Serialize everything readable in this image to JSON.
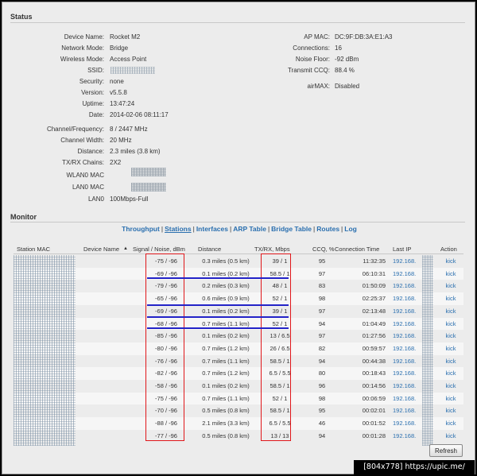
{
  "status": {
    "title": "Status",
    "left": [
      {
        "label": "Device Name:",
        "value": "Rocket M2"
      },
      {
        "label": "Network Mode:",
        "value": "Bridge"
      },
      {
        "label": "Wireless Mode:",
        "value": "Access Point"
      },
      {
        "label": "SSID:",
        "value": ""
      },
      {
        "label": "Security:",
        "value": "none"
      },
      {
        "label": "Version:",
        "value": "v5.5.8"
      },
      {
        "label": "Uptime:",
        "value": "13:47:24"
      },
      {
        "label": "Date:",
        "value": "2014-02-06 08:11:17"
      },
      {
        "label": "Channel/Frequency:",
        "value": "8 / 2447 MHz"
      },
      {
        "label": "Channel Width:",
        "value": "20 MHz"
      },
      {
        "label": "Distance:",
        "value": "2.3 miles (3.8 km)"
      },
      {
        "label": "TX/RX Chains:",
        "value": "2X2"
      },
      {
        "label": "WLAN0 MAC",
        "value": ""
      },
      {
        "label": "LAN0 MAC",
        "value": ""
      },
      {
        "label": "LAN0",
        "value": "100Mbps-Full"
      }
    ],
    "right": [
      {
        "label": "AP MAC:",
        "value": "DC:9F:DB:3A:E1:A3"
      },
      {
        "label": "Connections:",
        "value": "16"
      },
      {
        "label": "Noise Floor:",
        "value": "-92 dBm"
      },
      {
        "label": "Transmit CCQ:",
        "value": "88.4 %"
      },
      {
        "label": "airMAX:",
        "value": "Disabled"
      }
    ]
  },
  "monitor": {
    "title": "Monitor",
    "tabs": [
      "Throughput",
      "Stations",
      "Interfaces",
      "ARP Table",
      "Bridge Table",
      "Routes",
      "Log"
    ],
    "active_tab": "Stations",
    "columns": [
      "Station MAC",
      "Device Name",
      "Signal / Noise, dBm",
      "Distance",
      "TX/RX, Mbps",
      "CCQ, %",
      "Connection Time",
      "Last IP",
      "Action"
    ],
    "sort_indicator": "▲",
    "rows": [
      {
        "signal": "-75 / -96",
        "distance": "0.3 miles (0.5 km)",
        "txrx": "39 / 1",
        "ccq": "95",
        "time": "11:32:35",
        "ip": "192.168.",
        "action": "kick"
      },
      {
        "signal": "-69 / -96",
        "distance": "0.1 miles (0.2 km)",
        "txrx": "58.5 / 1",
        "ccq": "97",
        "time": "06:10:31",
        "ip": "192.168.",
        "action": "kick"
      },
      {
        "signal": "-79 / -96",
        "distance": "0.2 miles (0.3 km)",
        "txrx": "48 / 1",
        "ccq": "83",
        "time": "01:50:09",
        "ip": "192.168.",
        "action": "kick"
      },
      {
        "signal": "-65 / -96",
        "distance": "0.6 miles (0.9 km)",
        "txrx": "52 / 1",
        "ccq": "98",
        "time": "02:25:37",
        "ip": "192.168.",
        "action": "kick"
      },
      {
        "signal": "-69 / -96",
        "distance": "0.1 miles (0.2 km)",
        "txrx": "39 / 1",
        "ccq": "97",
        "time": "02:13:48",
        "ip": "192.168.",
        "action": "kick"
      },
      {
        "signal": "-68 / -96",
        "distance": "0.7 miles (1.1 km)",
        "txrx": "52 / 1",
        "ccq": "94",
        "time": "01:04:49",
        "ip": "192.168.",
        "action": "kick"
      },
      {
        "signal": "-85 / -96",
        "distance": "0.1 miles (0.2 km)",
        "txrx": "13 / 6.5",
        "ccq": "97",
        "time": "01:27:56",
        "ip": "192.168.",
        "action": "kick"
      },
      {
        "signal": "-80 / -96",
        "distance": "0.7 miles (1.2 km)",
        "txrx": "26 / 6.5",
        "ccq": "82",
        "time": "00:59:57",
        "ip": "192.168.",
        "action": "kick"
      },
      {
        "signal": "-76 / -96",
        "distance": "0.7 miles (1.1 km)",
        "txrx": "58.5 / 1",
        "ccq": "94",
        "time": "00:44:38",
        "ip": "192.168.",
        "action": "kick"
      },
      {
        "signal": "-82 / -96",
        "distance": "0.7 miles (1.2 km)",
        "txrx": "6.5 / 5.5",
        "ccq": "80",
        "time": "00:18:43",
        "ip": "192.168.",
        "action": "kick"
      },
      {
        "signal": "-58 / -96",
        "distance": "0.1 miles (0.2 km)",
        "txrx": "58.5 / 1",
        "ccq": "96",
        "time": "00:14:56",
        "ip": "192.168.",
        "action": "kick"
      },
      {
        "signal": "-75 / -96",
        "distance": "0.7 miles (1.1 km)",
        "txrx": "52 / 1",
        "ccq": "98",
        "time": "00:06:59",
        "ip": "192.168.",
        "action": "kick"
      },
      {
        "signal": "-70 / -96",
        "distance": "0.5 miles (0.8 km)",
        "txrx": "58.5 / 1",
        "ccq": "95",
        "time": "00:02:01",
        "ip": "192.168.",
        "action": "kick"
      },
      {
        "signal": "-88 / -96",
        "distance": "2.1 miles (3.3 km)",
        "txrx": "6.5 / 5.5",
        "ccq": "46",
        "time": "00:01:52",
        "ip": "192.168.",
        "action": "kick"
      },
      {
        "signal": "-77 / -96",
        "distance": "0.5 miles (0.8 km)",
        "txrx": "13 / 13",
        "ccq": "94",
        "time": "00:01:28",
        "ip": "192.168.",
        "action": "kick"
      }
    ],
    "refresh_label": "Refresh"
  },
  "watermark": "[804x778] https://upic.me/",
  "colors": {
    "link": "#2a6faf",
    "annotation_red": "#e0161a",
    "annotation_blue": "#2323c8"
  }
}
